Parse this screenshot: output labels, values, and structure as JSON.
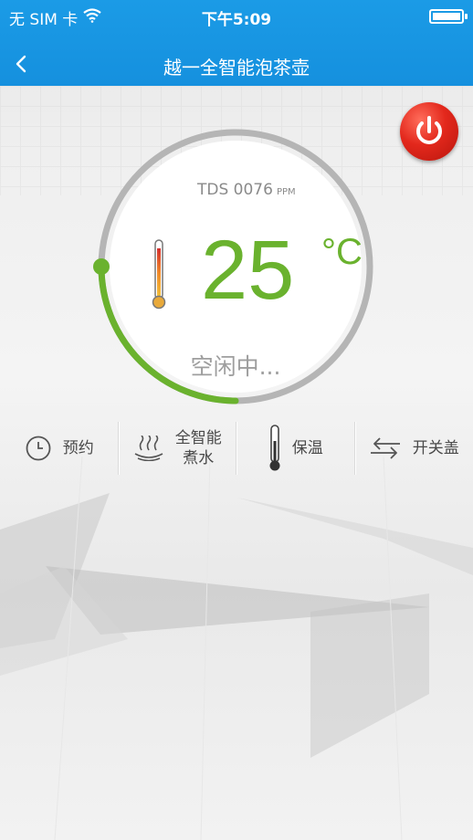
{
  "status_bar": {
    "carrier": "无 SIM 卡",
    "time": "下午5:09",
    "battery_level": 1.0
  },
  "nav": {
    "back_icon": "chevron-left-icon",
    "title": "越一全智能泡茶壶"
  },
  "power": {
    "icon": "power-icon",
    "color": "#e3281c"
  },
  "dial": {
    "tds_label": "TDS 0076",
    "tds_unit": "PPM",
    "temperature": "25",
    "temperature_unit": "°C",
    "state": "空闲中...",
    "accent_color": "#6ab22e",
    "progress_fraction": 0.25
  },
  "functions": [
    {
      "icon": "clock-icon",
      "label": "预约"
    },
    {
      "icon": "steam-icon",
      "label_line1": "全智能",
      "label_line2": "煮水"
    },
    {
      "icon": "thermometer-icon",
      "label": "保温"
    },
    {
      "icon": "arrows-icon",
      "label": "开关盖"
    }
  ]
}
